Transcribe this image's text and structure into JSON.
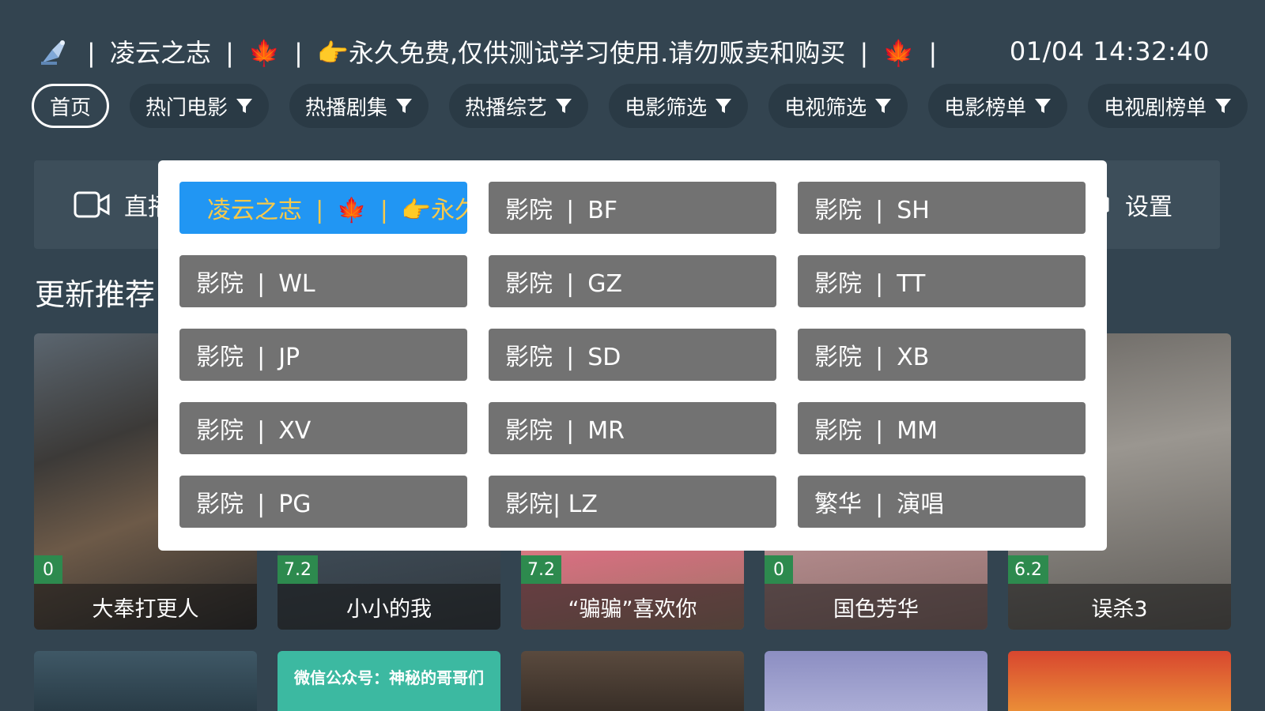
{
  "header": {
    "marquee": "❘ 凌云之志 ❘ 🍁 ❘ 👉永久免费,仅供测试学习使用.请勿贩卖和购买 ❘ 🍁 ❘",
    "clock": "01/04 14:32:40"
  },
  "tabs": [
    {
      "label": "首页"
    },
    {
      "label": "热门电影"
    },
    {
      "label": "热播剧集"
    },
    {
      "label": "热播综艺"
    },
    {
      "label": "电影筛选"
    },
    {
      "label": "电视筛选"
    },
    {
      "label": "电影榜单"
    },
    {
      "label": "电视剧榜单"
    }
  ],
  "quickbar": {
    "live_label": "直播",
    "settings_label": "设置"
  },
  "section": {
    "title": "更新推荐"
  },
  "posters": [
    {
      "title": "大奉打更人",
      "score": "0"
    },
    {
      "title": "小小的我",
      "score": "7.2"
    },
    {
      "title": "“骗骗”喜欢你",
      "score": "7.2"
    },
    {
      "title": "国色芳华",
      "score": "0"
    },
    {
      "title": "误杀3",
      "score": "6.2"
    }
  ],
  "row2": {
    "wechat_text": "微信公众号：神秘的哥哥们"
  },
  "overlay": {
    "sources": [
      {
        "label": "凌云之志 ❘ 🍁 ❘ 👉永久"
      },
      {
        "label": "影院 ❘ BF"
      },
      {
        "label": "影院 ❘ SH"
      },
      {
        "label": "影院 ❘ WL"
      },
      {
        "label": "影院 ❘ GZ"
      },
      {
        "label": "影院 ❘ TT"
      },
      {
        "label": "影院 ❘ JP"
      },
      {
        "label": "影院 ❘ SD"
      },
      {
        "label": "影院 ❘ XB"
      },
      {
        "label": "影院 ❘ XV"
      },
      {
        "label": "影院 ❘ MR"
      },
      {
        "label": "影院 ❘ MM"
      },
      {
        "label": "影院 ❘ PG"
      },
      {
        "label": "影院| LZ"
      },
      {
        "label": "繁华 ❘ 演唱"
      }
    ]
  },
  "colors": {
    "background": "#334450",
    "tab_bg": "#2a3a45",
    "overlay_bg": "#ffffff",
    "source_bg": "#727272",
    "source_selected_bg": "#2196f3",
    "source_selected_text": "#f7c94a",
    "score_badge": "#2d8a4e"
  },
  "icons": {
    "status": "satellite-icon",
    "tab_filter": "funnel-icon",
    "live": "video-camera-icon",
    "settings": "settings-icon"
  }
}
